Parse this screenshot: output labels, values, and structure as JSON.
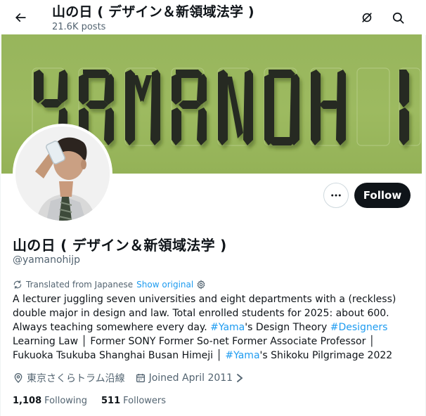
{
  "header": {
    "title": "山の日 ( デザイン＆新領域法学 )",
    "posts": "21.6K posts",
    "back_icon": "arrow-left-icon",
    "grok_icon": "grok-icon",
    "search_icon": "search-icon"
  },
  "banner": {
    "text": "YAMANOHI",
    "background": "#9dba60"
  },
  "profile": {
    "display_name": "山の日 ( デザイン＆新領域法学 )",
    "handle": "@yamanohijp",
    "follow_label": "Follow",
    "more_icon": "more-icon"
  },
  "translation": {
    "note": "Translated from Japanese",
    "show_original": "Show original"
  },
  "bio": {
    "part1": "A lecturer juggling seven universities and eight departments with a (reckless) double major in design and law. Total enrolled students for 2025: about 600. Always teaching somewhere every day. ",
    "tag1": "#Yama",
    "part2": "'s Design Theory ",
    "tag2": "#Designers",
    "part3": " Learning Law │ Former SONY Former So-net Former Associate Professor │ Fukuoka Tsukuba Shanghai Busan Himeji │ ",
    "tag3": "#Yama",
    "part4": "'s Shikoku Pilgrimage 2022"
  },
  "meta": {
    "location": "東京さくらトラム沿線",
    "joined": "Joined April 2011"
  },
  "stats": {
    "following_count": "1,108",
    "following_label": "Following",
    "followers_count": "511",
    "followers_label": "Followers"
  },
  "colors": {
    "accent": "#1d9bf0",
    "text": "#0f1419",
    "secondary": "#536471",
    "follow_bg": "#0f1419"
  }
}
